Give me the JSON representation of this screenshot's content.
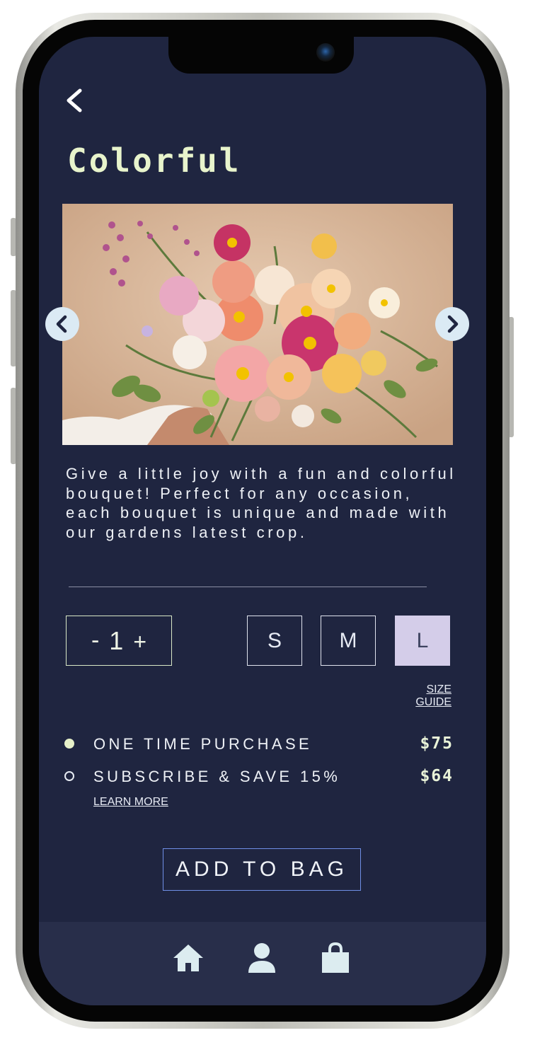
{
  "header": {
    "back_icon": "chevron-left-icon",
    "title": "Colorful"
  },
  "carousel": {
    "prev_icon": "chevron-left-icon",
    "next_icon": "chevron-right-icon"
  },
  "product": {
    "description": "Give a little joy with a fun and colorful bouquet! Perfect for any occasion, each bouquet is unique and made with our gardens latest crop."
  },
  "quantity": {
    "minus_label": "-",
    "value": "1",
    "plus_label": "+"
  },
  "sizes": {
    "options": [
      "S",
      "M",
      "L"
    ],
    "selected": "L",
    "guide_label": "SIZE GUIDE"
  },
  "purchase_options": [
    {
      "label": "ONE TIME PURCHASE",
      "price": "$75",
      "selected": true
    },
    {
      "label": "SUBSCRIBE & SAVE 15%",
      "price": "$64",
      "selected": false
    }
  ],
  "learn_more_label": "LEARN MORE",
  "add_to_bag_label": "ADD TO BAG",
  "bottom_nav": {
    "items": [
      "home-icon",
      "user-icon",
      "shopping-bag-icon"
    ]
  },
  "colors": {
    "background": "#1f2540",
    "accent_text": "#e8f4cc",
    "selected_size": "#d4cde9",
    "button_border": "#6f8fe6",
    "nav_background": "#282e4a"
  }
}
